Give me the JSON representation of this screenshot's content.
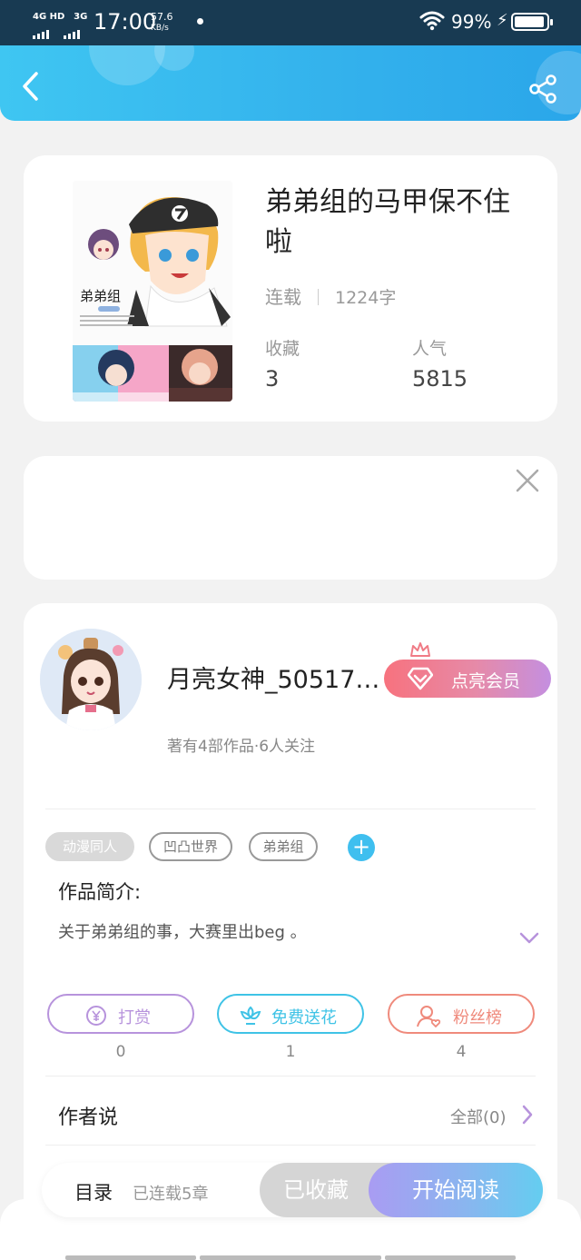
{
  "status_bar": {
    "network": "4G HD",
    "network2": "3G",
    "time": "17:00",
    "speed_value": "57.6",
    "speed_unit": "KB/s",
    "battery": "99%"
  },
  "book": {
    "title": "弟弟组的马甲保不住啦",
    "status": "连载",
    "word_count": "1224字",
    "cover_text": "弟弟组",
    "stats": [
      {
        "label": "收藏",
        "value": "3"
      },
      {
        "label": "人气",
        "value": "5815"
      }
    ]
  },
  "author": {
    "name": "月亮女神_50517…",
    "meta": "著有4部作品·6人关注",
    "vip_label": "点亮会员"
  },
  "tags": [
    "动漫同人",
    "凹凸世界",
    "弟弟组"
  ],
  "intro": {
    "label": "作品简介:",
    "text": "关于弟弟组的事，大赛里出beg 。"
  },
  "actions": [
    {
      "label": "打赏",
      "count": "0",
      "color": "#b793dc"
    },
    {
      "label": "免费送花",
      "count": "1",
      "color": "#3fc3e6"
    },
    {
      "label": "粉丝榜",
      "count": "4",
      "color": "#ef8a7c"
    }
  ],
  "author_says": {
    "label": "作者说",
    "all_link": "全部(0)"
  },
  "bottom_bar": {
    "toc": "目录",
    "chapters": "已连载5章",
    "collected": "已收藏",
    "start": "开始阅读"
  },
  "colors": {
    "header": "#33b1ec",
    "accent": "#3fbfef",
    "vip": "#f7727e",
    "purple": "#b793dc"
  }
}
